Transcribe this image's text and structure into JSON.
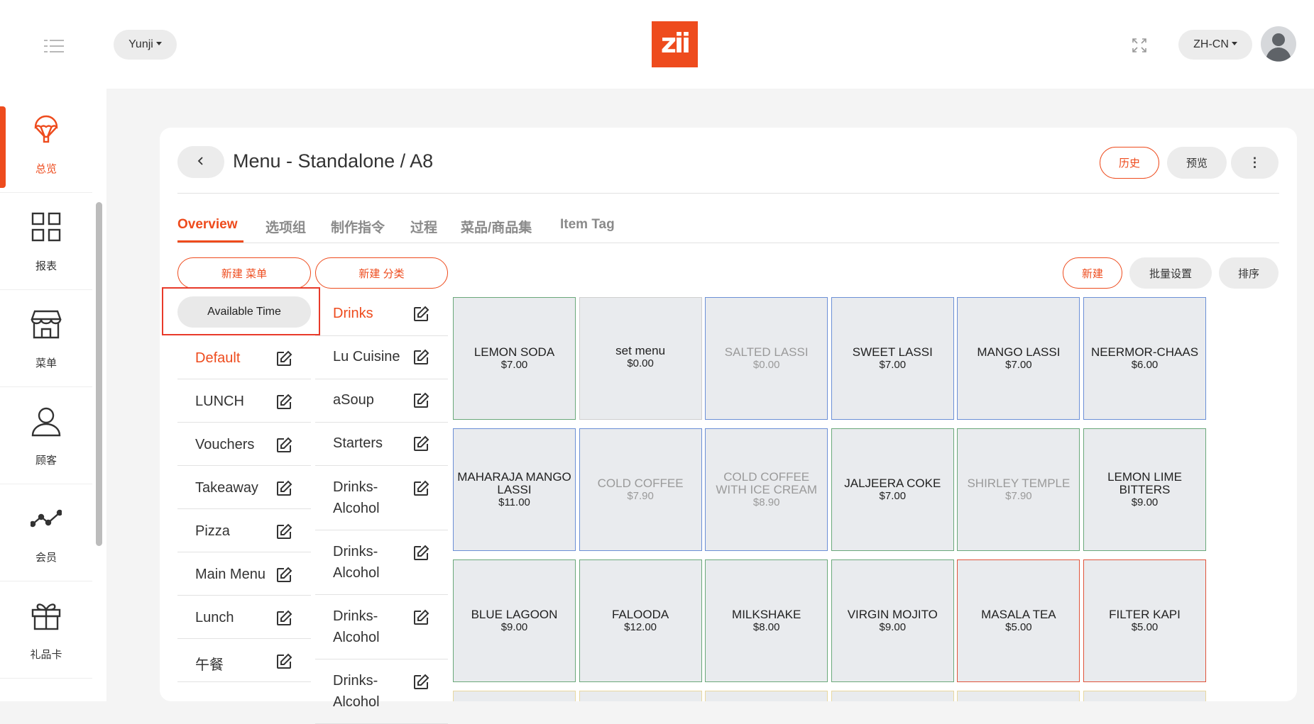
{
  "header": {
    "store": "Yunji",
    "logo_text": "zii",
    "language": "ZH-CN",
    "brand_color": "#ee4b1d"
  },
  "sidebar": {
    "items": [
      {
        "label": "总览",
        "icon": "parachute-icon",
        "active": true
      },
      {
        "label": "报表",
        "icon": "grid-icon"
      },
      {
        "label": "菜单",
        "icon": "store-icon"
      },
      {
        "label": "顾客",
        "icon": "user-icon"
      },
      {
        "label": "会员",
        "icon": "trend-icon"
      },
      {
        "label": "礼品卡",
        "icon": "gift-icon"
      }
    ]
  },
  "page": {
    "title": "Menu - Standalone / A8",
    "history": "历史",
    "preview": "预览",
    "more": "⋮"
  },
  "tabs": [
    "Overview",
    "选项组",
    "制作指令",
    "过程",
    "菜品/商品集",
    "Item Tag"
  ],
  "actions": {
    "new_menu": "新建 菜单",
    "new_category": "新建 分类",
    "available_time": "Available Time",
    "new": "新建",
    "batch": "批量设置",
    "sort": "排序"
  },
  "menus": [
    "Default",
    "LUNCH",
    "Vouchers",
    "Takeaway",
    "Pizza",
    "Main Menu",
    "Lunch",
    "午餐"
  ],
  "categories": [
    "Drinks",
    "Lu Cuisine",
    "aSoup",
    "Starters",
    "Drinks-Alcohol",
    "Drinks-Alcohol",
    "Drinks-Alcohol",
    "Drinks-Alcohol"
  ],
  "items": [
    {
      "name": "LEMON SODA",
      "price": "$7.00",
      "border": "#6aa87a"
    },
    {
      "name": "set menu",
      "price": "$0.00",
      "border": "#cfcfcf",
      "lower": true
    },
    {
      "name": "SALTED LASSI",
      "price": "$0.00",
      "border": "#6b8fd6",
      "dim": true
    },
    {
      "name": "SWEET LASSI",
      "price": "$7.00",
      "border": "#6b8fd6"
    },
    {
      "name": "MANGO LASSI",
      "price": "$7.00",
      "border": "#6b8fd6"
    },
    {
      "name": "NEERMOR-CHAAS",
      "price": "$6.00",
      "border": "#6b8fd6"
    },
    {
      "name": "MAHARAJA MANGO LASSI",
      "price": "$11.00",
      "border": "#6b8fd6"
    },
    {
      "name": "COLD COFFEE",
      "price": "$7.90",
      "border": "#6b8fd6",
      "dim": true
    },
    {
      "name": "COLD COFFEE WITH ICE CREAM",
      "price": "$8.90",
      "border": "#6b8fd6",
      "dim": true
    },
    {
      "name": "JALJEERA COKE",
      "price": "$7.00",
      "border": "#6aa87a"
    },
    {
      "name": "SHIRLEY TEMPLE",
      "price": "$7.90",
      "border": "#6aa87a",
      "dim": true
    },
    {
      "name": "LEMON LIME BITTERS",
      "price": "$9.00",
      "border": "#6aa87a"
    },
    {
      "name": "BLUE LAGOON",
      "price": "$9.00",
      "border": "#6aa87a"
    },
    {
      "name": "FALOODA",
      "price": "$12.00",
      "border": "#6aa87a"
    },
    {
      "name": "MILKSHAKE",
      "price": "$8.00",
      "border": "#6aa87a"
    },
    {
      "name": "VIRGIN MOJITO",
      "price": "$9.00",
      "border": "#6aa87a"
    },
    {
      "name": "MASALA TEA",
      "price": "$5.00",
      "border": "#e0533a"
    },
    {
      "name": "FILTER KAPI",
      "price": "$5.00",
      "border": "#e0533a"
    }
  ]
}
